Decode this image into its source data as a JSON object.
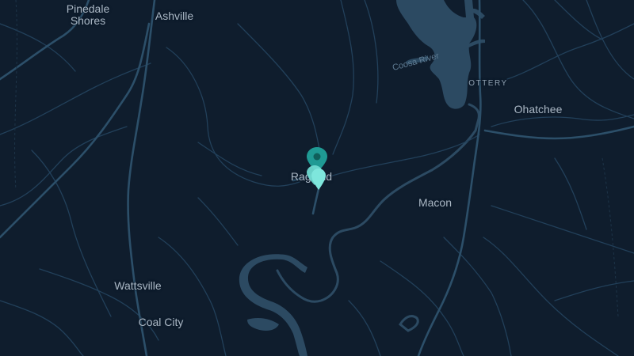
{
  "map": {
    "theme_colors": {
      "background": "#0f1d2d",
      "road": "#26445c",
      "road_major": "#2c4f69",
      "water": "#2c4a62",
      "label": "#aab7c4",
      "marker_primary": "#1f9a94",
      "marker_light": "#6fdad1"
    },
    "labels": {
      "pinedale": "Pinedale",
      "shores": "Shores",
      "ashville": "Ashville",
      "coosa_river": "Coosa River",
      "ottery": "OTTERY",
      "ohatchee": "Ohatchee",
      "ragland": "Ragland",
      "macon": "Macon",
      "wattsville": "Wattsville",
      "coal_city": "Coal City"
    },
    "markers": [
      {
        "icon": "map-pin-icon",
        "color": "#1f9a94"
      },
      {
        "icon": "map-pin-icon",
        "color": "#6fdad1"
      },
      {
        "icon": "map-pin-icon",
        "color": "#6fdad1"
      }
    ]
  }
}
